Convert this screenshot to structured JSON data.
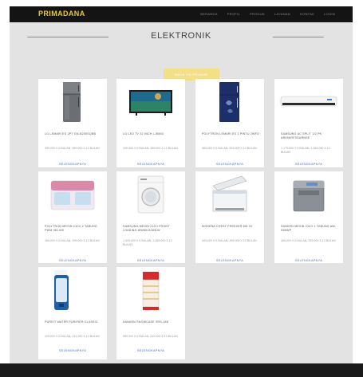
{
  "colors": {
    "navbar_bg": "#141414",
    "brand": "#e8c92c",
    "page_bg": "#e3e3e3",
    "accent_button": "#f3df87",
    "link": "#3f6bc4"
  },
  "brand": "PRIMADANA",
  "nav": [
    "BERANDA",
    "PROFIL",
    "PRODUK",
    "LAYANAN",
    "KONTAK",
    "LOGIN"
  ],
  "page_title": "ELEKTRONIK",
  "hero_button_label": "BACK TO PRODUK",
  "detail_label": "SELENGKAPNYA",
  "products": [
    {
      "name": "LG LEMARI ES 2PT GN-B205SQBB",
      "price": "399.000 X 6 BULAN, 469.000 X 12 BULAN",
      "icon": "refrigerator-icon"
    },
    {
      "name": "LG LED TV 32 INCH LJ500D",
      "price": "349.000 X 6 BULAN, 389.000 X 12 BULAN",
      "icon": "television-icon"
    },
    {
      "name": "POLYTRON LEMARI ES 2 PINTU 2WFD",
      "price": "469.000 X 6 BULAN, 529.000 X 12 BULAN",
      "icon": "refrigerator-icon"
    },
    {
      "name": "SAMSUNG AC SPLIT 1/2 PK AR05KRFSSURNSE",
      "price": "1.179.000 X 6 BULAN, 1.369.000 X 12 BULAN",
      "icon": "air-conditioner-icon"
    },
    {
      "name": "POLYTRON MESIN CUCI 2 TABUNG PWM 981 MS",
      "price": "369.000 X 6 BULAN, 399.000 X 12 BULAN",
      "icon": "washing-machine-icon"
    },
    {
      "name": "SAMSUNG MESIN CUCI FRONT LOADING WW65J3283LW",
      "price": "1.049.000 X 6 BULAN, 1.159.000 X 12 BULAN",
      "icon": "washing-machine-icon"
    },
    {
      "name": "MODENA CHEST FREEZER MD 10",
      "price": "449.000 X 6 BULAN, 499.000 X 12 BULAN",
      "icon": "freezer-icon"
    },
    {
      "name": "SANKEN MESIN CUCI 1 TABUNG AW-S85WP",
      "price": "269.000 X 6 BULAN, 319.000 X 12 BULAN",
      "icon": "washing-machine-icon"
    },
    {
      "name": "PUREIT WATER PURIFIER CLASSIC",
      "price": "229.000 X 6 BULAN, 241.000 X 12 BULAN",
      "icon": "water-purifier-icon"
    },
    {
      "name": "SANKEN SHOWCASE SRS-188",
      "price": "589.000 X 6 BULAN, 619.000 X 12 BULAN",
      "icon": "showcase-icon"
    }
  ]
}
